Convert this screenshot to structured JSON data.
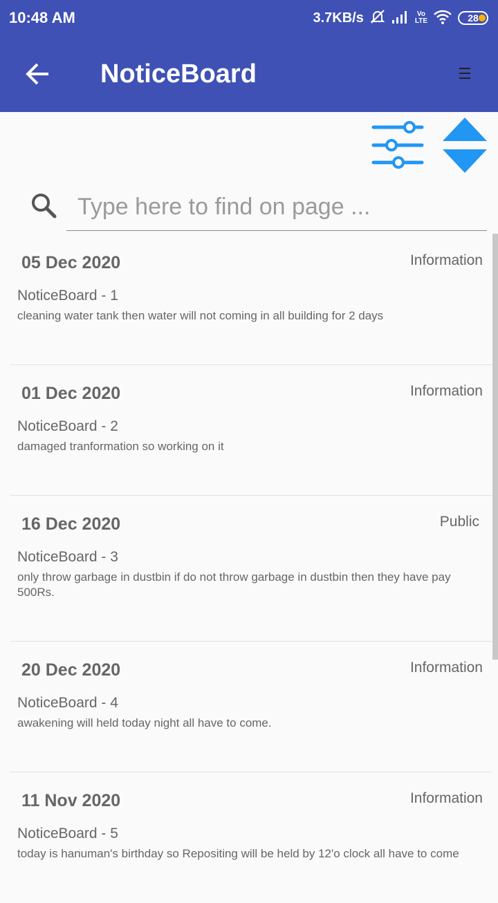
{
  "status_bar": {
    "time": "10:48 AM",
    "network_speed": "3.7KB/s",
    "volte_top": "Vo",
    "volte_bottom": "LTE",
    "battery": "28",
    "icons": [
      "mute-alarm-icon",
      "signal-icon",
      "volte-icon",
      "wifi-icon",
      "battery-icon"
    ]
  },
  "app_bar": {
    "title": "NoticeBoard",
    "back_icon": "arrow-back-icon",
    "menu_icon": "menu-icon",
    "background": "#3f51b5"
  },
  "toolbar": {
    "filter_icon": "sliders-filter-icon",
    "sort_icon": "sort-up-down-icon",
    "icon_color": "#2196f3"
  },
  "search": {
    "placeholder": "Type here to find on page ...",
    "value": ""
  },
  "notices": [
    {
      "date": "05 Dec 2020",
      "type": "Information",
      "title": "NoticeBoard - 1",
      "description": "cleaning water tank then water will not coming in all building for 2 days"
    },
    {
      "date": "01 Dec 2020",
      "type": "Information",
      "title": "NoticeBoard - 2",
      "description": "damaged tranformation so working on it"
    },
    {
      "date": "16 Dec 2020",
      "type": "Public",
      "title": "NoticeBoard - 3",
      "description": "only throw garbage in dustbin if do not throw garbage in dustbin then they have pay 500Rs."
    },
    {
      "date": "20 Dec 2020",
      "type": "Information",
      "title": "NoticeBoard - 4",
      "description": "awakening will held today night all have to come."
    },
    {
      "date": "11 Nov 2020",
      "type": "Information",
      "title": "NoticeBoard - 5",
      "description": "today is hanuman's birthday so Repositing will be held by 12'o clock all have to come"
    }
  ]
}
